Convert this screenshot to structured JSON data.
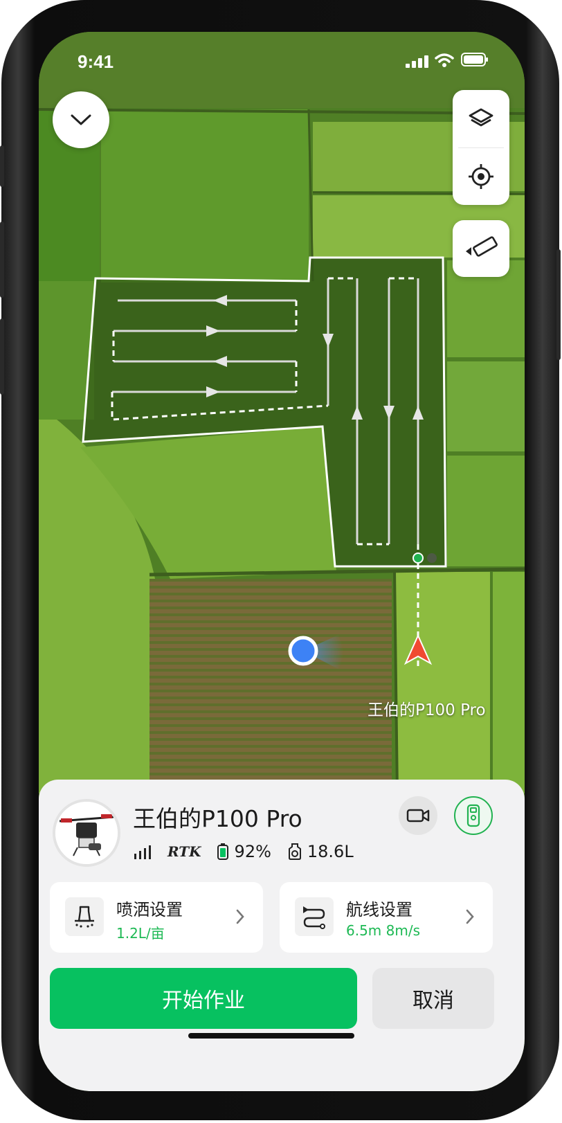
{
  "status_bar": {
    "time": "9:41"
  },
  "map": {
    "drone_label": "王伯的P100 Pro"
  },
  "panel": {
    "drone_name": "王伯的P100 Pro",
    "rtk_label": "RTK",
    "battery": "92%",
    "tank": "18.6L",
    "spray_card": {
      "title": "喷洒设置",
      "value": "1.2L/亩"
    },
    "route_card": {
      "title": "航线设置",
      "value": "6.5m 8m/s"
    },
    "start_label": "开始作业",
    "cancel_label": "取消"
  },
  "colors": {
    "accent_green": "#07C160",
    "drone_arrow": "#F04A32",
    "user_dot": "#3D82F5"
  }
}
